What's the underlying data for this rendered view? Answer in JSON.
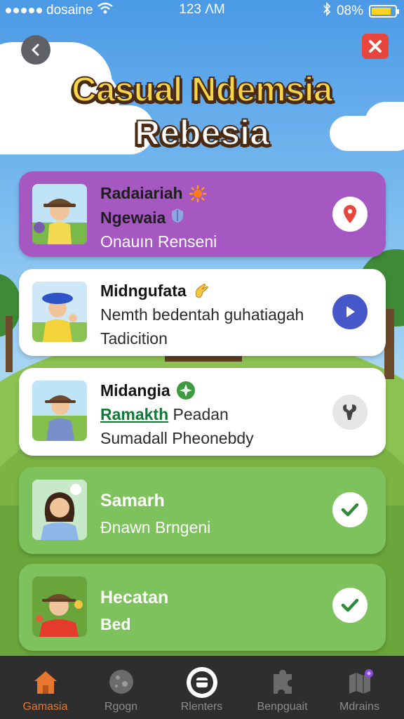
{
  "status_bar": {
    "carrier": "dosaine",
    "time": "123 ɅM",
    "battery_percent": "08%",
    "battery_level": 0.85,
    "icons": [
      "signal-dots-icon",
      "wifi-icon",
      "bluetooth-icon",
      "battery-icon"
    ]
  },
  "header": {
    "title_line1": "Casual Ndemsia",
    "title_line2": "Rebesia",
    "back_icon": "chevron-left-icon",
    "close_icon": "close-icon"
  },
  "cards": [
    {
      "title": "Radaiariah",
      "title_icon": "sun-icon",
      "line2": "Ngewaia",
      "line2_icon": "shield-icon",
      "line3": "Onauın Renseni",
      "action_icon": "location-pin-icon",
      "style": "purple"
    },
    {
      "title": "Midnɡufata",
      "title_icon": "hand-wave-icon",
      "line2": "Nemth bedentah guhatiagah",
      "line3": "Tadicition",
      "action_icon": "play-icon",
      "style": "white"
    },
    {
      "title": "Midangia",
      "title_icon": "compass-icon",
      "line2_link": "Ramakth",
      "line2": "Peadan",
      "line3": "Sumadall Pheonebdy",
      "action_icon": "wrench-icon",
      "style": "white"
    },
    {
      "title": "Samarh",
      "line2": "Ɖnawn Brngeni",
      "action_icon": "check-icon",
      "style": "green"
    },
    {
      "title": "Hecatan",
      "line2": "Bed",
      "action_icon": "check-icon",
      "style": "green"
    }
  ],
  "tabs": [
    {
      "label": "Gamasia",
      "icon": "home-icon",
      "active": true
    },
    {
      "label": "Rgogn",
      "icon": "globe-icon",
      "active": false
    },
    {
      "label": "Rlenters",
      "icon": "record-icon",
      "active": false
    },
    {
      "label": "Benpguait",
      "icon": "puzzle-icon",
      "active": false
    },
    {
      "label": "Mdrains",
      "icon": "map-icon",
      "active": false
    }
  ],
  "colors": {
    "card_purple": "#a557c2",
    "card_green": "#7ec25d",
    "pin_red": "#e8453c",
    "play_blue": "#4557c9",
    "check_green": "#2e8b3a",
    "tab_active": "#e8772e",
    "title_yellow": "#f7d549"
  }
}
